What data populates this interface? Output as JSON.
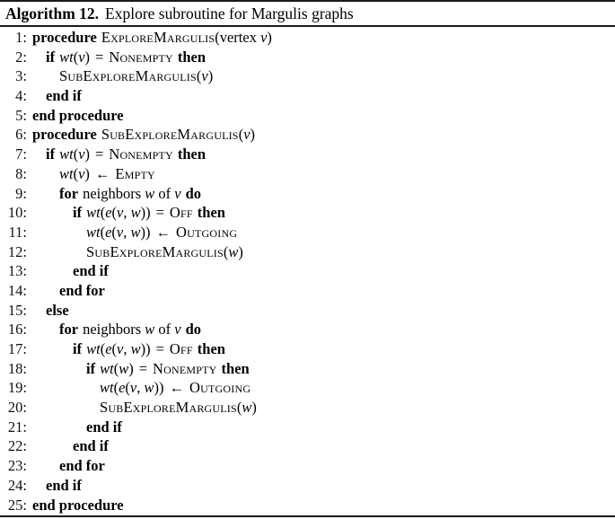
{
  "caption": {
    "label": "Algorithm 12.",
    "text": "Explore subroutine for Margulis graphs"
  },
  "keywords": {
    "procedure": "procedure",
    "end_procedure": "end procedure",
    "if": "if",
    "then": "then",
    "end_if": "end if",
    "for": "for",
    "do": "do",
    "end_for": "end for",
    "else": "else",
    "neighbors": "neighbors",
    "of": "of",
    "vertex": "vertex"
  },
  "identifiers": {
    "explore_margulis": "ExploreMargulis",
    "sub_explore_margulis": "SubExploreMargulis",
    "nonempty": "Nonempty",
    "empty": "Empty",
    "off": "Off",
    "outgoing": "Outgoing"
  },
  "symbols": {
    "assign": "←",
    "equals": "=",
    "lparen": "(",
    "rparen": ")",
    "comma": ",",
    "wt": "wt",
    "e": "e",
    "v": "v",
    "w": "w"
  },
  "lines": [
    {
      "n": "1",
      "indent": 0
    },
    {
      "n": "2",
      "indent": 1
    },
    {
      "n": "3",
      "indent": 2
    },
    {
      "n": "4",
      "indent": 1
    },
    {
      "n": "5",
      "indent": 0
    },
    {
      "n": "6",
      "indent": 0
    },
    {
      "n": "7",
      "indent": 1
    },
    {
      "n": "8",
      "indent": 2
    },
    {
      "n": "9",
      "indent": 2
    },
    {
      "n": "10",
      "indent": 3
    },
    {
      "n": "11",
      "indent": 4
    },
    {
      "n": "12",
      "indent": 4
    },
    {
      "n": "13",
      "indent": 3
    },
    {
      "n": "14",
      "indent": 2
    },
    {
      "n": "15",
      "indent": 1
    },
    {
      "n": "16",
      "indent": 2
    },
    {
      "n": "17",
      "indent": 3
    },
    {
      "n": "18",
      "indent": 4
    },
    {
      "n": "19",
      "indent": 5
    },
    {
      "n": "20",
      "indent": 5
    },
    {
      "n": "21",
      "indent": 4
    },
    {
      "n": "22",
      "indent": 3
    },
    {
      "n": "23",
      "indent": 2
    },
    {
      "n": "24",
      "indent": 1
    },
    {
      "n": "25",
      "indent": 0
    }
  ],
  "line_text": {
    "l1": "procedure ExploreMargulis(vertex v)",
    "l2": "if wt(v) = Nonempty then",
    "l3": "SubExploreMargulis(v)",
    "l4": "end if",
    "l5": "end procedure",
    "l6": "procedure SubExploreMargulis(v)",
    "l7": "if wt(v) = Nonempty then",
    "l8": "wt(v) ← Empty",
    "l9": "for neighbors w of v do",
    "l10": "if wt(e(v, w)) = Off then",
    "l11": "wt(e(v, w)) ← Outgoing",
    "l12": "SubExploreMargulis(w)",
    "l13": "end if",
    "l14": "end for",
    "l15": "else",
    "l16": "for neighbors w of v do",
    "l17": "if wt(e(v, w)) = Off then",
    "l18": "if wt(w) = Nonempty then",
    "l19": "wt(e(v, w)) ← Outgoing",
    "l20": "SubExploreMargulis(w)",
    "l21": "end if",
    "l22": "end if",
    "l23": "end for",
    "l24": "end if",
    "l25": "end procedure"
  }
}
